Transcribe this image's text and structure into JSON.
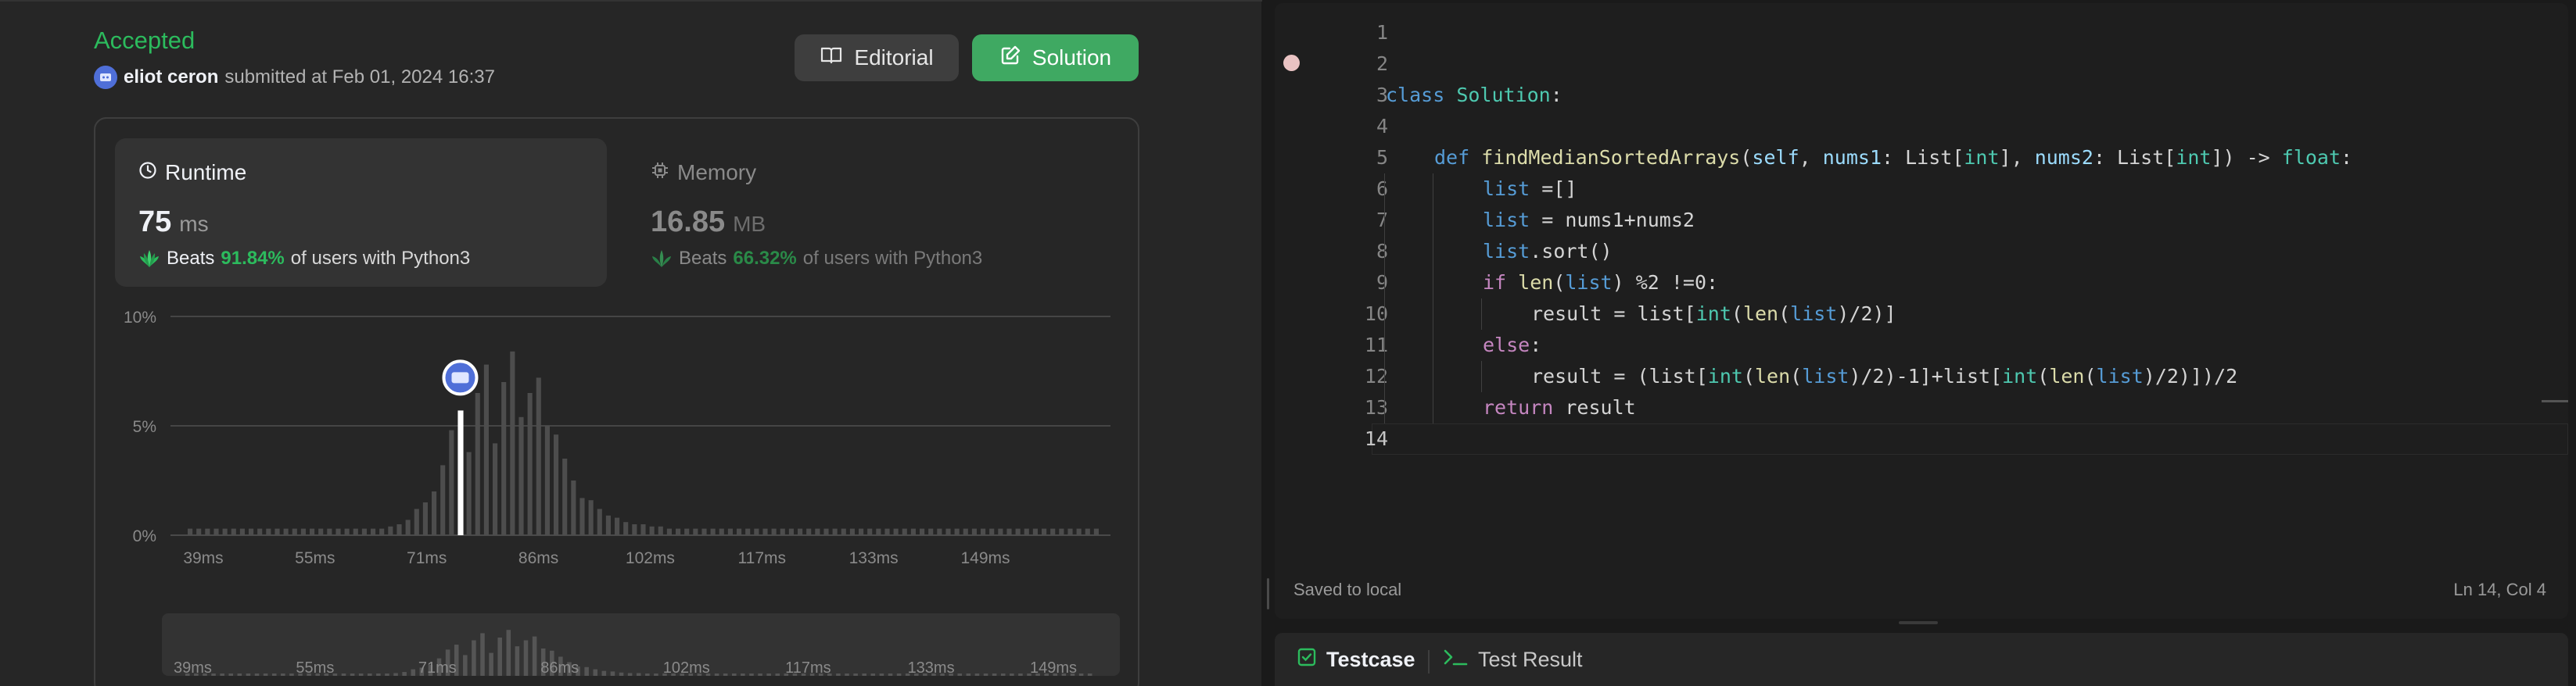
{
  "submission": {
    "status": "Accepted",
    "user": "eliot ceron",
    "submitted_text": "submitted at Feb 01, 2024 16:37"
  },
  "buttons": {
    "editorial": "Editorial",
    "solution": "Solution"
  },
  "runtime": {
    "title": "Runtime",
    "value": "75",
    "unit": "ms",
    "beats_word": "Beats",
    "beats_pct": "91.84%",
    "beats_suffix": "of users with Python3"
  },
  "memory": {
    "title": "Memory",
    "value": "16.85",
    "unit": "MB",
    "beats_word": "Beats",
    "beats_pct": "66.32%",
    "beats_suffix": "of users with Python3"
  },
  "chart_data": {
    "type": "bar",
    "y_ticks": [
      "10%",
      "5%",
      "0%"
    ],
    "ylim": [
      0,
      10
    ],
    "x_ticks": [
      "39ms",
      "55ms",
      "71ms",
      "86ms",
      "102ms",
      "117ms",
      "133ms",
      "149ms"
    ],
    "values": [
      0.3,
      0.3,
      0.3,
      0.3,
      0.3,
      0.3,
      0.3,
      0.3,
      0.3,
      0.3,
      0.3,
      0.3,
      0.3,
      0.3,
      0.3,
      0.3,
      0.3,
      0.3,
      0.3,
      0.3,
      0.3,
      0.3,
      0.3,
      0.4,
      0.5,
      0.7,
      1.2,
      1.5,
      2.0,
      3.2,
      4.8,
      5.7,
      3.8,
      6.5,
      7.8,
      4.2,
      7.0,
      8.4,
      5.4,
      6.5,
      7.2,
      5.0,
      4.6,
      3.5,
      2.5,
      1.7,
      1.6,
      1.2,
      0.9,
      0.8,
      0.6,
      0.5,
      0.5,
      0.4,
      0.4,
      0.3,
      0.3,
      0.3,
      0.3,
      0.3,
      0.3,
      0.3,
      0.3,
      0.3,
      0.3,
      0.3,
      0.3,
      0.3,
      0.3,
      0.3,
      0.3,
      0.3,
      0.3,
      0.3,
      0.3,
      0.3,
      0.3,
      0.3,
      0.3,
      0.3,
      0.3,
      0.3,
      0.3,
      0.3,
      0.3,
      0.3,
      0.3,
      0.3,
      0.3,
      0.3,
      0.3,
      0.3,
      0.3,
      0.3,
      0.3,
      0.3,
      0.3,
      0.3,
      0.3,
      0.3,
      0.3,
      0.3,
      0.3,
      0.3,
      0.3
    ],
    "highlight_index": 31,
    "highlight_label": "75 ms",
    "grid": true
  },
  "navigator": {
    "x_ticks": [
      "39ms",
      "55ms",
      "71ms",
      "86ms",
      "102ms",
      "117ms",
      "133ms",
      "149ms"
    ]
  },
  "editor": {
    "lines": [
      {
        "n": "1",
        "tokens": []
      },
      {
        "n": "2",
        "tokens": []
      },
      {
        "n": "3",
        "tokens": [
          [
            "t-kw",
            "class "
          ],
          [
            "t-cls",
            "Solution"
          ],
          [
            "t-plain",
            ":"
          ]
        ]
      },
      {
        "n": "4",
        "tokens": []
      },
      {
        "n": "5",
        "indent": 1,
        "tokens": [
          [
            "t-kw",
            "def "
          ],
          [
            "t-fn",
            "findMedianSortedArrays"
          ],
          [
            "t-plain",
            "("
          ],
          [
            "t-param",
            "self"
          ],
          [
            "t-plain",
            ", "
          ],
          [
            "t-param",
            "nums1"
          ],
          [
            "t-plain",
            ": List["
          ],
          [
            "t-type",
            "int"
          ],
          [
            "t-plain",
            "], "
          ],
          [
            "t-param",
            "nums2"
          ],
          [
            "t-plain",
            ": List["
          ],
          [
            "t-type",
            "int"
          ],
          [
            "t-plain",
            "]) -> "
          ],
          [
            "t-type",
            "float"
          ],
          [
            "t-plain",
            ":"
          ]
        ]
      },
      {
        "n": "6",
        "indent": 2,
        "tokens": [
          [
            "t-kw",
            "list"
          ],
          [
            "t-plain",
            " =[]"
          ]
        ]
      },
      {
        "n": "7",
        "indent": 2,
        "tokens": [
          [
            "t-kw",
            "list"
          ],
          [
            "t-plain",
            " = nums1+nums2"
          ]
        ]
      },
      {
        "n": "8",
        "indent": 2,
        "tokens": [
          [
            "t-kw",
            "list"
          ],
          [
            "t-plain",
            ".sort()"
          ]
        ]
      },
      {
        "n": "9",
        "indent": 2,
        "tokens": [
          [
            "t-ctl",
            "if "
          ],
          [
            "t-fn",
            "len"
          ],
          [
            "t-plain",
            "("
          ],
          [
            "t-kw",
            "list"
          ],
          [
            "t-plain",
            ") %2 !=0:"
          ]
        ]
      },
      {
        "n": "10",
        "indent": 3,
        "tokens": [
          [
            "t-plain",
            "result = list["
          ],
          [
            "t-cls",
            "int"
          ],
          [
            "t-plain",
            "("
          ],
          [
            "t-fn",
            "len"
          ],
          [
            "t-plain",
            "("
          ],
          [
            "t-kw",
            "list"
          ],
          [
            "t-plain",
            ")/2)]"
          ]
        ]
      },
      {
        "n": "11",
        "indent": 2,
        "tokens": [
          [
            "t-ctl",
            "else"
          ],
          [
            "t-plain",
            ":"
          ]
        ]
      },
      {
        "n": "12",
        "indent": 3,
        "tokens": [
          [
            "t-plain",
            "result = (list["
          ],
          [
            "t-cls",
            "int"
          ],
          [
            "t-plain",
            "("
          ],
          [
            "t-fn",
            "len"
          ],
          [
            "t-plain",
            "("
          ],
          [
            "t-kw",
            "list"
          ],
          [
            "t-plain",
            ")/2)-1]+list["
          ],
          [
            "t-cls",
            "int"
          ],
          [
            "t-plain",
            "("
          ],
          [
            "t-fn",
            "len"
          ],
          [
            "t-plain",
            "("
          ],
          [
            "t-kw",
            "list"
          ],
          [
            "t-plain",
            ")/2)])/2"
          ]
        ]
      },
      {
        "n": "13",
        "indent": 2,
        "tokens": [
          [
            "t-ctl",
            "return "
          ],
          [
            "t-plain",
            "result"
          ]
        ]
      },
      {
        "n": "14",
        "active": true,
        "tokens": []
      }
    ],
    "status_left": "Saved to local",
    "status_right": "Ln 14, Col 4"
  },
  "bottom_tabs": {
    "testcase": "Testcase",
    "test_result": "Test Result"
  },
  "colors": {
    "accent_green": "#2cbb5d",
    "solution_button": "#3fa962",
    "panel": "#262626",
    "editor_bg": "#1e1e1e"
  }
}
